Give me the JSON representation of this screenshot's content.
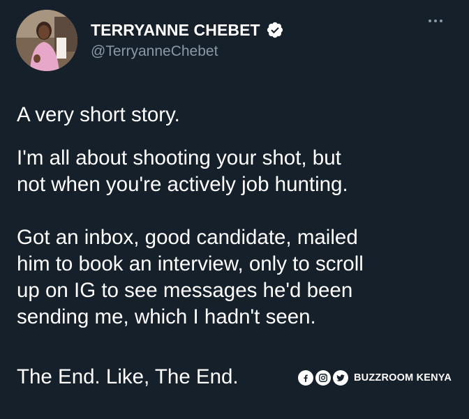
{
  "header": {
    "display_name": "TERRYANNE CHEBET",
    "handle": "@TerryanneChebet"
  },
  "tweet": {
    "line1": "A very short story.",
    "para2": [
      "I'm all about shooting your shot, but",
      "not when you're actively job hunting."
    ],
    "para3": [
      "Got an inbox,  good candidate, mailed",
      "him to book an interview, only to scroll",
      "up on IG to see messages he'd been",
      "sending me, which I hadn't seen."
    ],
    "last": "The End. Like, The End."
  },
  "watermark": {
    "text": "BUZZROOM KENYA",
    "icons": [
      "facebook-icon",
      "instagram-icon",
      "twitter-icon"
    ]
  },
  "colors": {
    "background": "#15202b",
    "text": "#ffffff",
    "secondary": "#8b98a5",
    "verified": "#ffffff"
  }
}
